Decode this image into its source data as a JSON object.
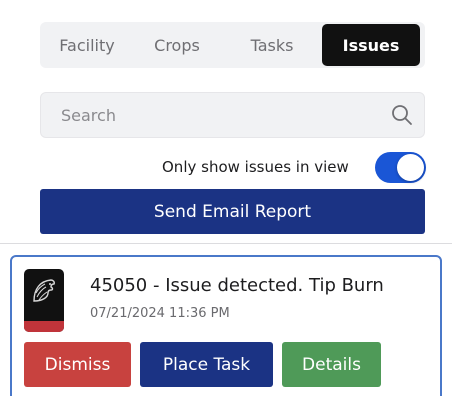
{
  "tabs": [
    {
      "label": "Facility",
      "active": false
    },
    {
      "label": "Crops",
      "active": false
    },
    {
      "label": "Tasks",
      "active": false
    },
    {
      "label": "Issues",
      "active": true
    }
  ],
  "search": {
    "placeholder": "Search",
    "value": ""
  },
  "filter": {
    "label": "Only show issues in view",
    "enabled": true
  },
  "send_report": {
    "label": "Send Email Report"
  },
  "issue": {
    "title": "45050 - Issue detected. Tip Burn",
    "timestamp": "07/21/2024 11:36 PM",
    "actions": {
      "dismiss": "Dismiss",
      "place_task": "Place Task",
      "details": "Details"
    }
  },
  "colors": {
    "active_tab": "#111111",
    "toggle_on": "#1a56d6",
    "primary": "#1b3384",
    "dismiss": "#c8423f",
    "details": "#4f9a58",
    "card_border": "#4a78c9"
  }
}
